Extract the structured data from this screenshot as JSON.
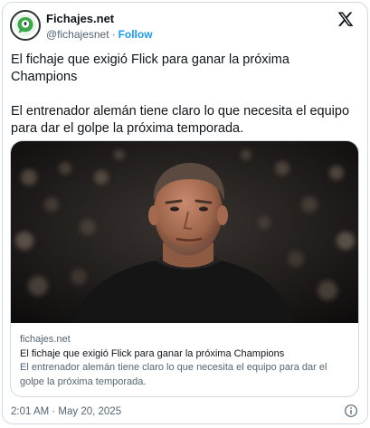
{
  "account": {
    "display_name": "Fichajes.net",
    "handle": "@fichajesnet",
    "separator": "·",
    "follow_label": "Follow"
  },
  "icons": {
    "avatar": "fichajes-logo-icon",
    "platform": "x-logo-icon",
    "info": "info-icon"
  },
  "tweet": {
    "headline": "El fichaje que exigió Flick para ganar la próxima Champions",
    "body": "El entrenador alemán tiene claro lo que necesita el equipo para dar el golpe la próxima temporada."
  },
  "link_card": {
    "domain": "fichajes.net",
    "title": "El fichaje que exigió Flick para ganar la próxima Champions",
    "description": "El entrenador alemán tiene claro lo que necesita el equipo para dar el golpe la próxima temporada."
  },
  "meta": {
    "timestamp": "2:01 AM · May 20, 2025"
  },
  "colors": {
    "accent": "#1d9bf0",
    "secondary_text": "#536471",
    "border": "#cfd9de",
    "logo_green": "#3aa74a"
  }
}
